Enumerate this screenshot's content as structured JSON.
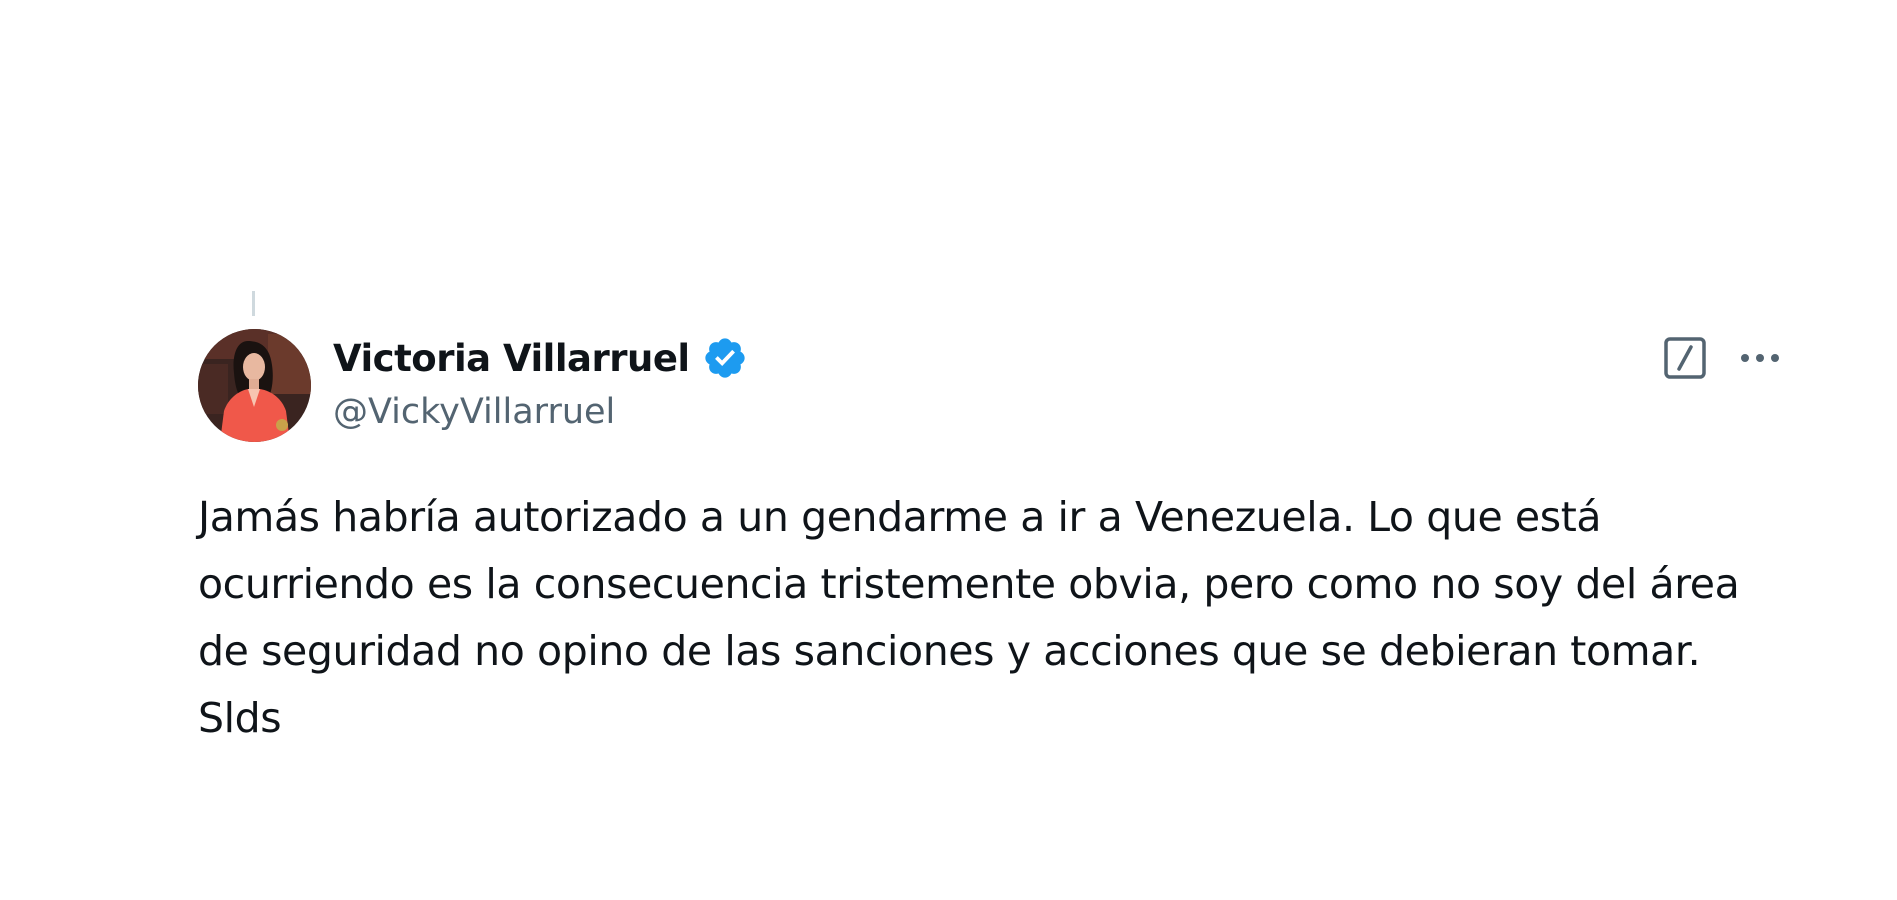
{
  "tweet": {
    "author": {
      "display_name": "Victoria Villarruel",
      "handle": "@VickyVillarruel",
      "verified": true,
      "avatar_icon": "profile-photo"
    },
    "text": "Jamás habría autorizado a un gendarme a ir a Venezuela. Lo que está ocurriendo es la consecuencia tristemente obvia, pero como no soy del área de seguridad no opino de las sanciones y acciones que se debieran tomar. Slds",
    "actions": {
      "grok_icon": "grok-icon",
      "more_icon": "more-options-icon"
    }
  },
  "colors": {
    "text_primary": "#0f1419",
    "text_secondary": "#536471",
    "verified_blue": "#1d9bf0",
    "icon_gray": "#536471",
    "thread_line": "#cfd9de"
  }
}
